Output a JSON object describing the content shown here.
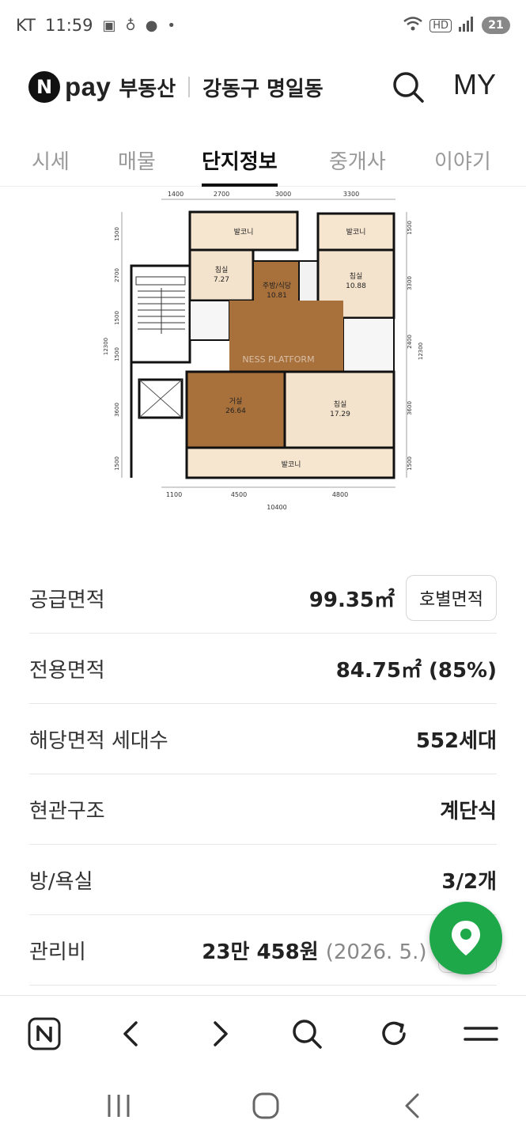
{
  "status": {
    "carrier": "KT",
    "time": "11:59",
    "battery": "21",
    "hd": "HD",
    "dot": "•"
  },
  "header": {
    "logo_letter": "N",
    "pay_word": "pay",
    "brand": "부동산",
    "location": "강동구 명일동",
    "my_label": "MY"
  },
  "tabs": [
    {
      "label": "시세"
    },
    {
      "label": "매물"
    },
    {
      "label": "단지정보"
    },
    {
      "label": "중개사"
    },
    {
      "label": "이야기"
    }
  ],
  "floorplan": {
    "top_dims": [
      "1400",
      "2700",
      "3000",
      "3300"
    ],
    "bottom_dims": [
      "1100",
      "4500",
      "4800"
    ],
    "bottom_total": "10400",
    "left_dims": [
      "1500",
      "2700",
      "1500",
      "1500",
      "3600",
      "1500"
    ],
    "left_total": "12300",
    "right_dims": [
      "1500",
      "3300",
      "2400",
      "3600",
      "1500"
    ],
    "right_total": "12300",
    "rooms": {
      "balcony_top_left": "발코니",
      "balcony_top_right": "발코니",
      "balcony_bottom": "발코니",
      "bed1_name": "침실",
      "bed1_area": "7.27",
      "kitchen_name": "주방/식당",
      "kitchen_area": "10.81",
      "bed2_name": "침실",
      "bed2_area": "10.88",
      "living_name": "거실",
      "living_area": "26.64",
      "bed3_name": "침실",
      "bed3_area": "17.29"
    },
    "watermark": "NESS PLATFORM"
  },
  "info": {
    "supply": {
      "label": "공급면적",
      "value": "99.35㎡",
      "button": "호별면적"
    },
    "exclusive": {
      "label": "전용면적",
      "value": "84.75㎡ (85%)"
    },
    "households": {
      "label": "해당면적 세대수",
      "value": "552세대"
    },
    "entrance": {
      "label": "현관구조",
      "value": "계단식"
    },
    "rooms": {
      "label": "방/욕실",
      "value": "3/2개"
    },
    "fee": {
      "label": "관리비",
      "value": "23만 458원",
      "date": "(2026. 5.)",
      "button": "상세"
    }
  },
  "colors": {
    "accent_green": "#1ea84a",
    "floor_wood": "#a8703b",
    "room_beige": "#f4e3cc"
  }
}
